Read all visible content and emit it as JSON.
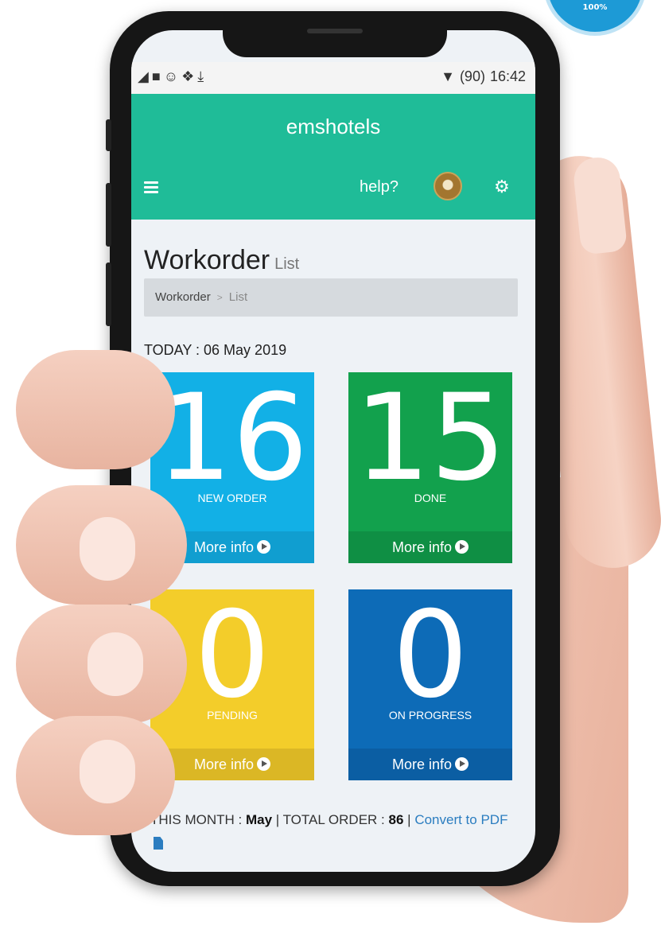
{
  "badge": {
    "text": "100%"
  },
  "status_bar": {
    "time": "16:42",
    "battery": "(90)"
  },
  "app": {
    "title": "emshotels",
    "help_label": "help?"
  },
  "page": {
    "title": "Workorder",
    "subtitle": "List",
    "breadcrumb": [
      "Workorder",
      "List"
    ],
    "today_label": "TODAY : 06 May 2019"
  },
  "tiles": {
    "new_order": {
      "count": "16",
      "label": "NEW ORDER",
      "link": "More info"
    },
    "done": {
      "count": "15",
      "label": "DONE",
      "link": "More info"
    },
    "pending": {
      "count": "0",
      "label": "PENDING",
      "link": "More info"
    },
    "on_progress": {
      "count": "0",
      "label": "ON PROGRESS",
      "link": "More info"
    }
  },
  "summary": {
    "month_label": "THIS MONTH :",
    "month_value": "May",
    "total_label": "TOTAL ORDER :",
    "total_value": "86",
    "convert_link": "Convert to PDF"
  },
  "colors": {
    "app_bar": "#1fbc98",
    "new_order": "#12b0e6",
    "done": "#12a14d",
    "pending": "#f3cd2a",
    "on_progress": "#0d6bb7"
  },
  "icons": [
    "signal-icon",
    "video-icon",
    "chat-icon",
    "dropbox-icon",
    "download-icon",
    "wifi-icon",
    "battery-icon",
    "menu-icon",
    "avatar",
    "settings-icon",
    "arrow-circle-right-icon",
    "pdf-file-icon"
  ]
}
